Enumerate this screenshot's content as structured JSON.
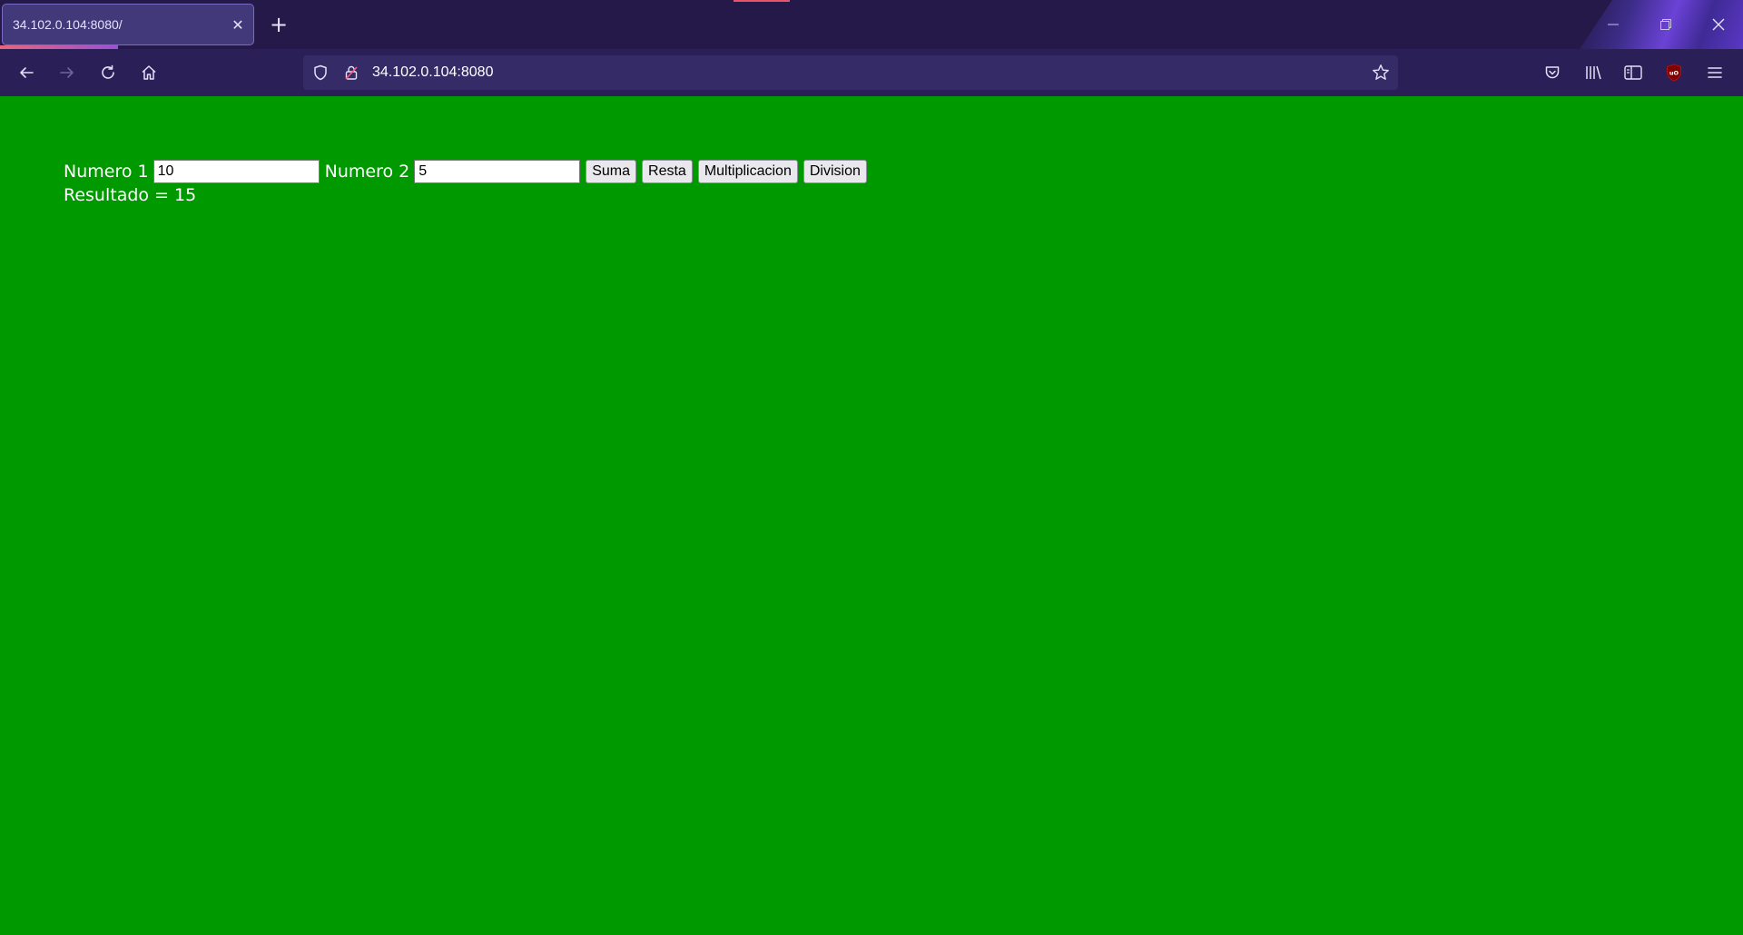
{
  "browser": {
    "tab": {
      "title": "34.102.0.104:8080/",
      "close_glyph": "✕"
    },
    "new_tab_glyph": "+",
    "url": "34.102.0.104:8080",
    "icons": {
      "back": "arrow-left-icon",
      "forward": "arrow-right-icon",
      "reload": "reload-icon",
      "home": "home-icon",
      "shield": "shield-icon",
      "lock": "lock-icon",
      "bookmark": "star-icon",
      "pocket": "pocket-icon",
      "library": "library-icon",
      "sidebar": "sidebar-icon",
      "ublock": "ublock-icon",
      "menu": "hamburger-menu-icon"
    },
    "colors": {
      "tabstrip": "#25194a",
      "navbar": "#2b1f58",
      "urlbar": "#352b66"
    }
  },
  "page": {
    "background": "#009900",
    "numero1_label": "Numero 1",
    "numero1_value": "10",
    "numero2_label": "Numero 2",
    "numero2_value": "5",
    "buttons": {
      "suma": "Suma",
      "resta": "Resta",
      "multiplicacion": "Multiplicacion",
      "division": "Division"
    },
    "result_text": "Resultado = 15"
  }
}
